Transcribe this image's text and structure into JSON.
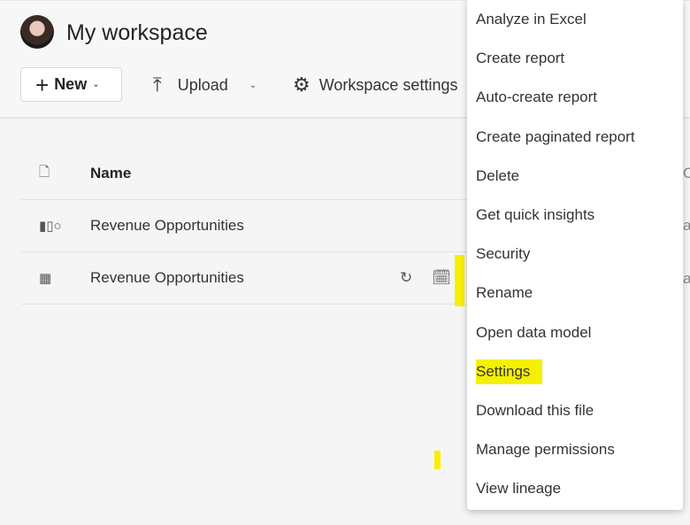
{
  "header": {
    "title": "My workspace",
    "new_label": "New",
    "upload_label": "Upload",
    "workspace_settings_label": "Workspace settings"
  },
  "table": {
    "name_header": "Name",
    "rows": [
      {
        "name": "Revenue Opportunities",
        "type": "report-icon"
      },
      {
        "name": "Revenue Opportunities",
        "type": "semantic-model-icon"
      }
    ],
    "clipped_header": "O",
    "clipped_cells": [
      "a",
      "a"
    ]
  },
  "menu": {
    "items": [
      "Analyze in Excel",
      "Create report",
      "Auto-create report",
      "Create paginated report",
      "Delete",
      "Get quick insights",
      "Security",
      "Rename",
      "Open data model",
      "Settings",
      "Download this file",
      "Manage permissions",
      "View lineage"
    ],
    "highlighted": "Settings"
  },
  "colors": {
    "highlight": "#f5f000"
  }
}
